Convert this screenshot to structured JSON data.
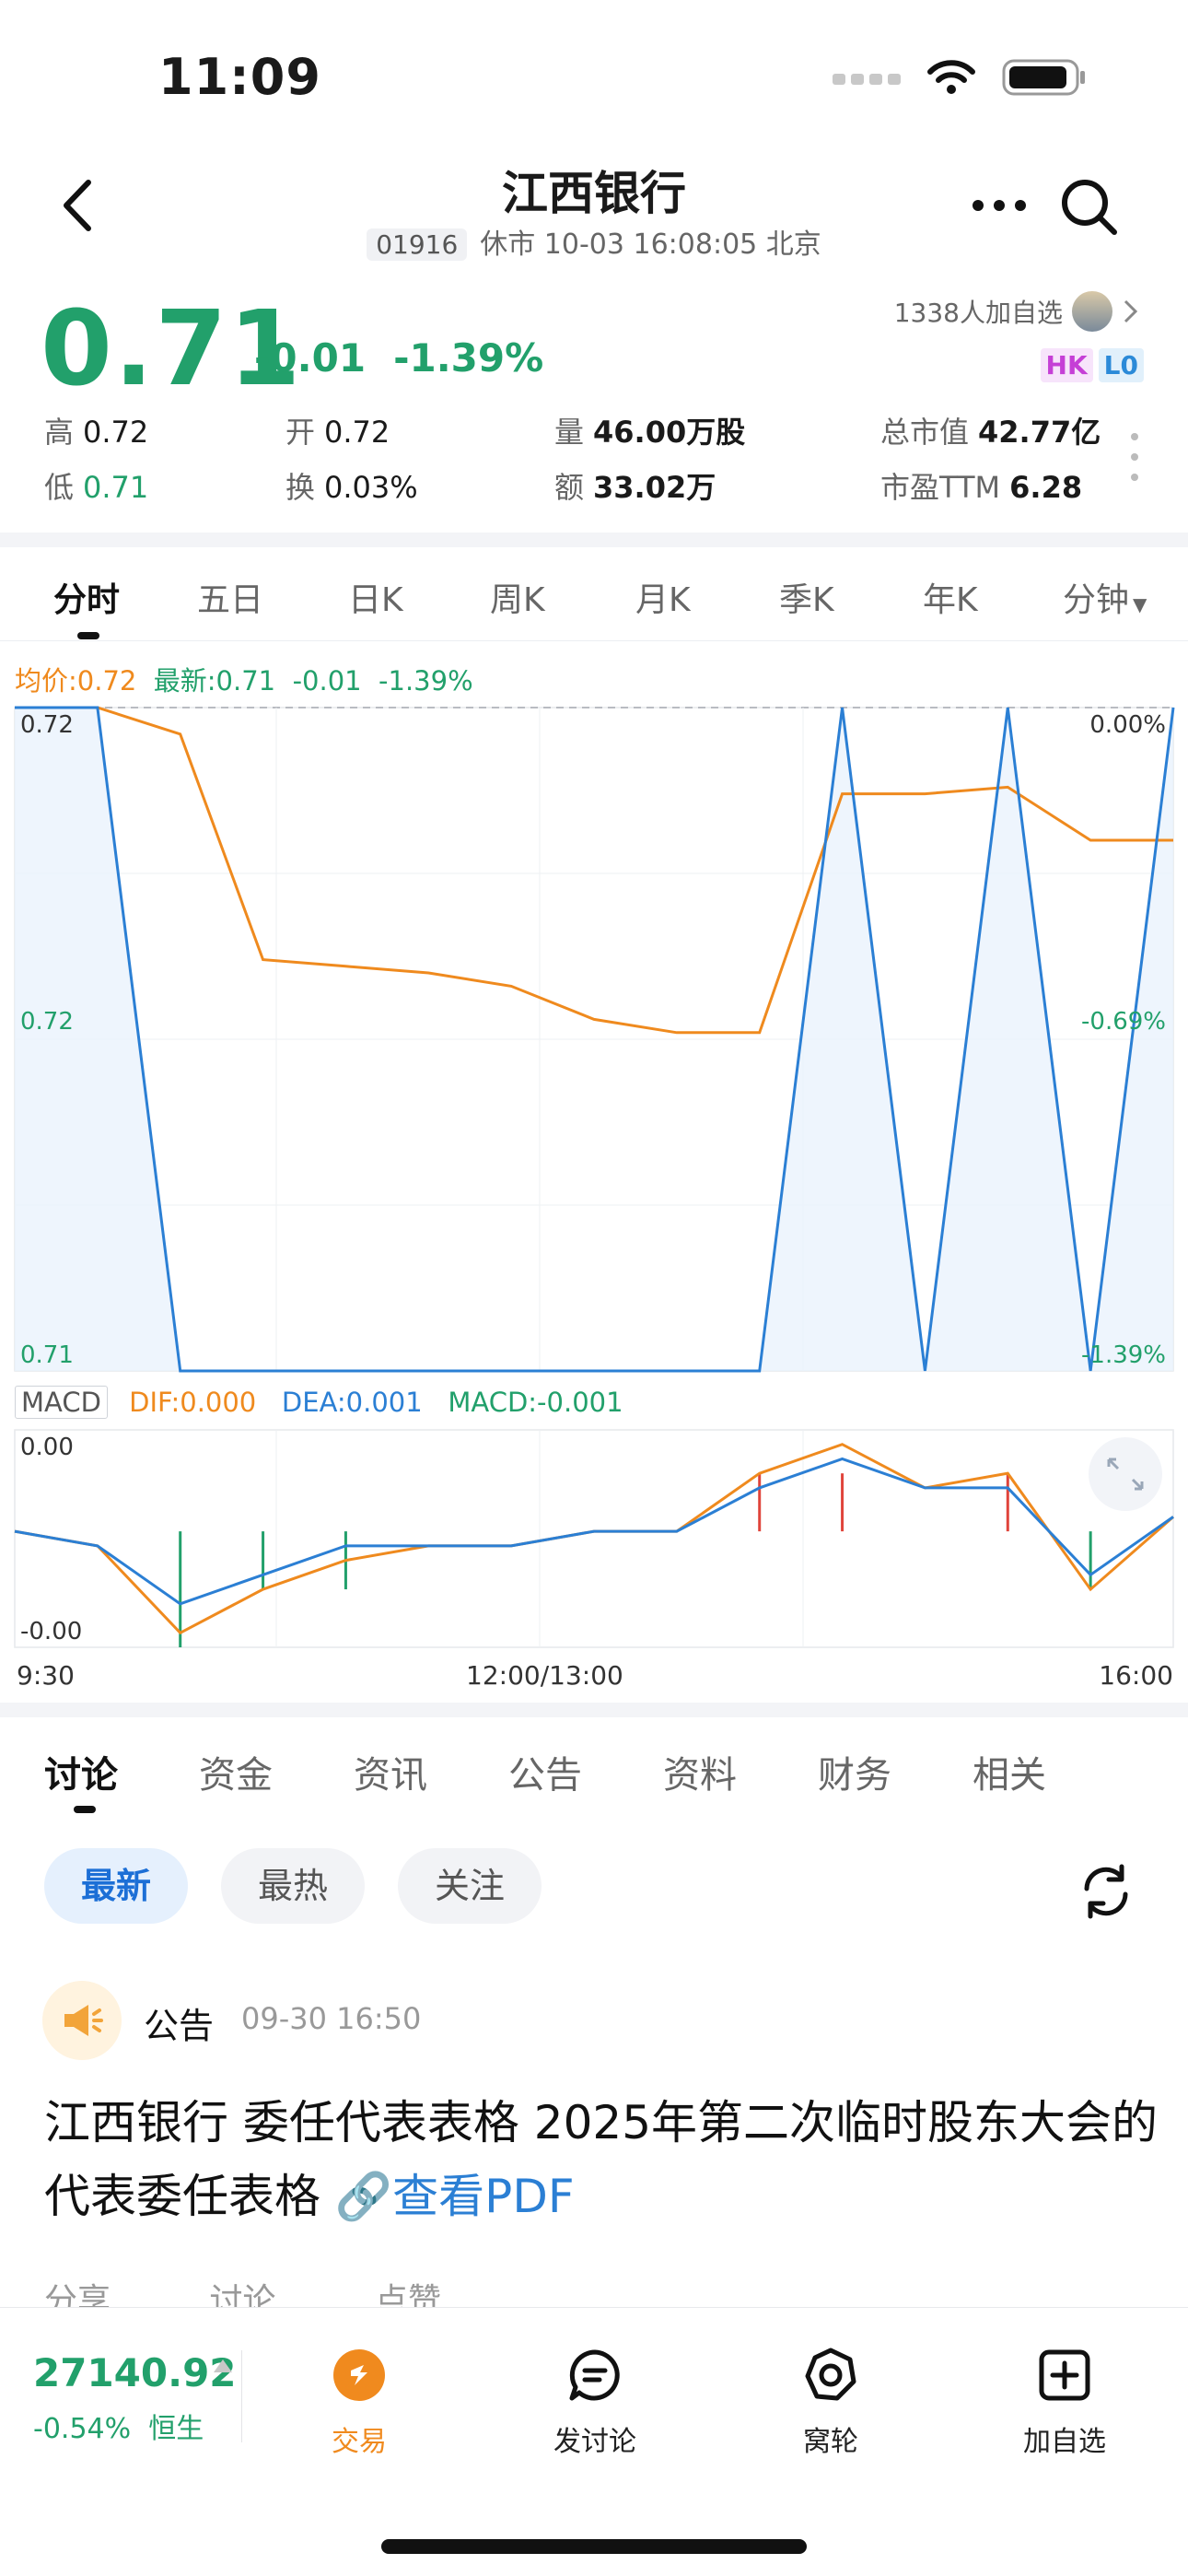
{
  "status": {
    "time": "11:09"
  },
  "nav": {
    "title": "江西银行",
    "code": "01916",
    "subtitle": "休市 10-03 16:08:05 北京"
  },
  "quote": {
    "price": "0.71",
    "change": "-0.01",
    "change_pct": "-1.39%",
    "watchers": "1338人加自选",
    "tag_hk": "HK",
    "tag_l0": "L0",
    "stats": {
      "high_label": "高",
      "high": "0.72",
      "low_label": "低",
      "low": "0.71",
      "open_label": "开",
      "open": "0.72",
      "turnover_label": "换",
      "turnover": "0.03%",
      "volume_label": "量",
      "volume": "46.00万股",
      "amount_label": "额",
      "amount": "33.02万",
      "mktcap_label": "总市值",
      "mktcap": "42.77亿",
      "pe_label": "市盈TTM",
      "pe": "6.28"
    }
  },
  "ktabs": [
    "分时",
    "五日",
    "日K",
    "周K",
    "月K",
    "季K",
    "年K",
    "分钟"
  ],
  "chart_legend": {
    "avg": "均价:0.72",
    "latest": "最新:0.71",
    "chg": "-0.01",
    "pct": "-1.39%"
  },
  "macd_legend": {
    "name": "MACD",
    "dif": "DIF:0.000",
    "dea": "DEA:0.001",
    "macd": "MACD:-0.001"
  },
  "chart_data": [
    {
      "type": "line",
      "name": "intraday",
      "y_left_ticks": [
        "0.72",
        "0.72",
        "0.71"
      ],
      "y_right_ticks": [
        "0.00%",
        "-0.69%",
        "-1.39%"
      ],
      "x_ticks": [
        "9:30",
        "12:00/13:00",
        "16:00"
      ],
      "x": [
        "09:30",
        "10:00",
        "10:06",
        "10:30",
        "11:00",
        "11:40",
        "12:00/13:00",
        "13:30",
        "14:00",
        "14:30",
        "14:40",
        "14:55",
        "15:00",
        "15:30",
        "16:00"
      ],
      "series": [
        {
          "values": [
            0.72,
            0.72,
            0.7196,
            0.7162,
            0.7161,
            0.716,
            0.7158,
            0.7153,
            0.7151,
            0.7151,
            0.7187,
            0.7187,
            0.7188,
            0.718,
            0.718
          ]
        },
        {
          "values": [
            0.72,
            0.72,
            0.71,
            0.71,
            0.71,
            0.71,
            0.71,
            0.71,
            0.71,
            0.71,
            0.72,
            0.71,
            0.72,
            0.71,
            0.72
          ]
        }
      ],
      "ylim": [
        0.71,
        0.72
      ]
    },
    {
      "type": "line",
      "name": "macd",
      "y_ticks": [
        "0.00",
        "-0.00"
      ],
      "series": [
        {
          "name": "DIF",
          "values": [
            0,
            -0.0001,
            -0.0007,
            -0.0004,
            -0.0002,
            -0.0001,
            -0.0001,
            0,
            0,
            0.0004,
            0.0006,
            0.0003,
            0.0004,
            -0.0004,
            0.0001
          ]
        },
        {
          "name": "DEA",
          "values": [
            0,
            -0.0001,
            -0.0005,
            -0.0003,
            -0.0001,
            -0.0001,
            -0.0001,
            0,
            0,
            0.0003,
            0.0005,
            0.0003,
            0.0003,
            -0.0003,
            0.0001
          ]
        }
      ],
      "ylim": [
        -0.0008,
        0.0007
      ]
    }
  ],
  "dtabs": [
    "讨论",
    "资金",
    "资讯",
    "公告",
    "资料",
    "财务",
    "相关"
  ],
  "filters": {
    "latest": "最新",
    "hot": "最热",
    "follow": "关注"
  },
  "post": {
    "source": "公告",
    "time": "09-30 16:50",
    "text": "江西银行 委任代表表格 2025年第二次临时股东大会的代表委任表格 ",
    "link": "🔗查看PDF",
    "share": "分享",
    "comment": "讨论",
    "like": "点赞"
  },
  "bottom": {
    "index_value": "27140.92",
    "index_change": "-0.54%",
    "index_name": "恒生",
    "nav": [
      "交易",
      "发讨论",
      "窝轮",
      "加自选"
    ]
  },
  "colors": {
    "up": "#22a06b",
    "accent": "#f08a1e",
    "blue": "#2b7fd4"
  }
}
